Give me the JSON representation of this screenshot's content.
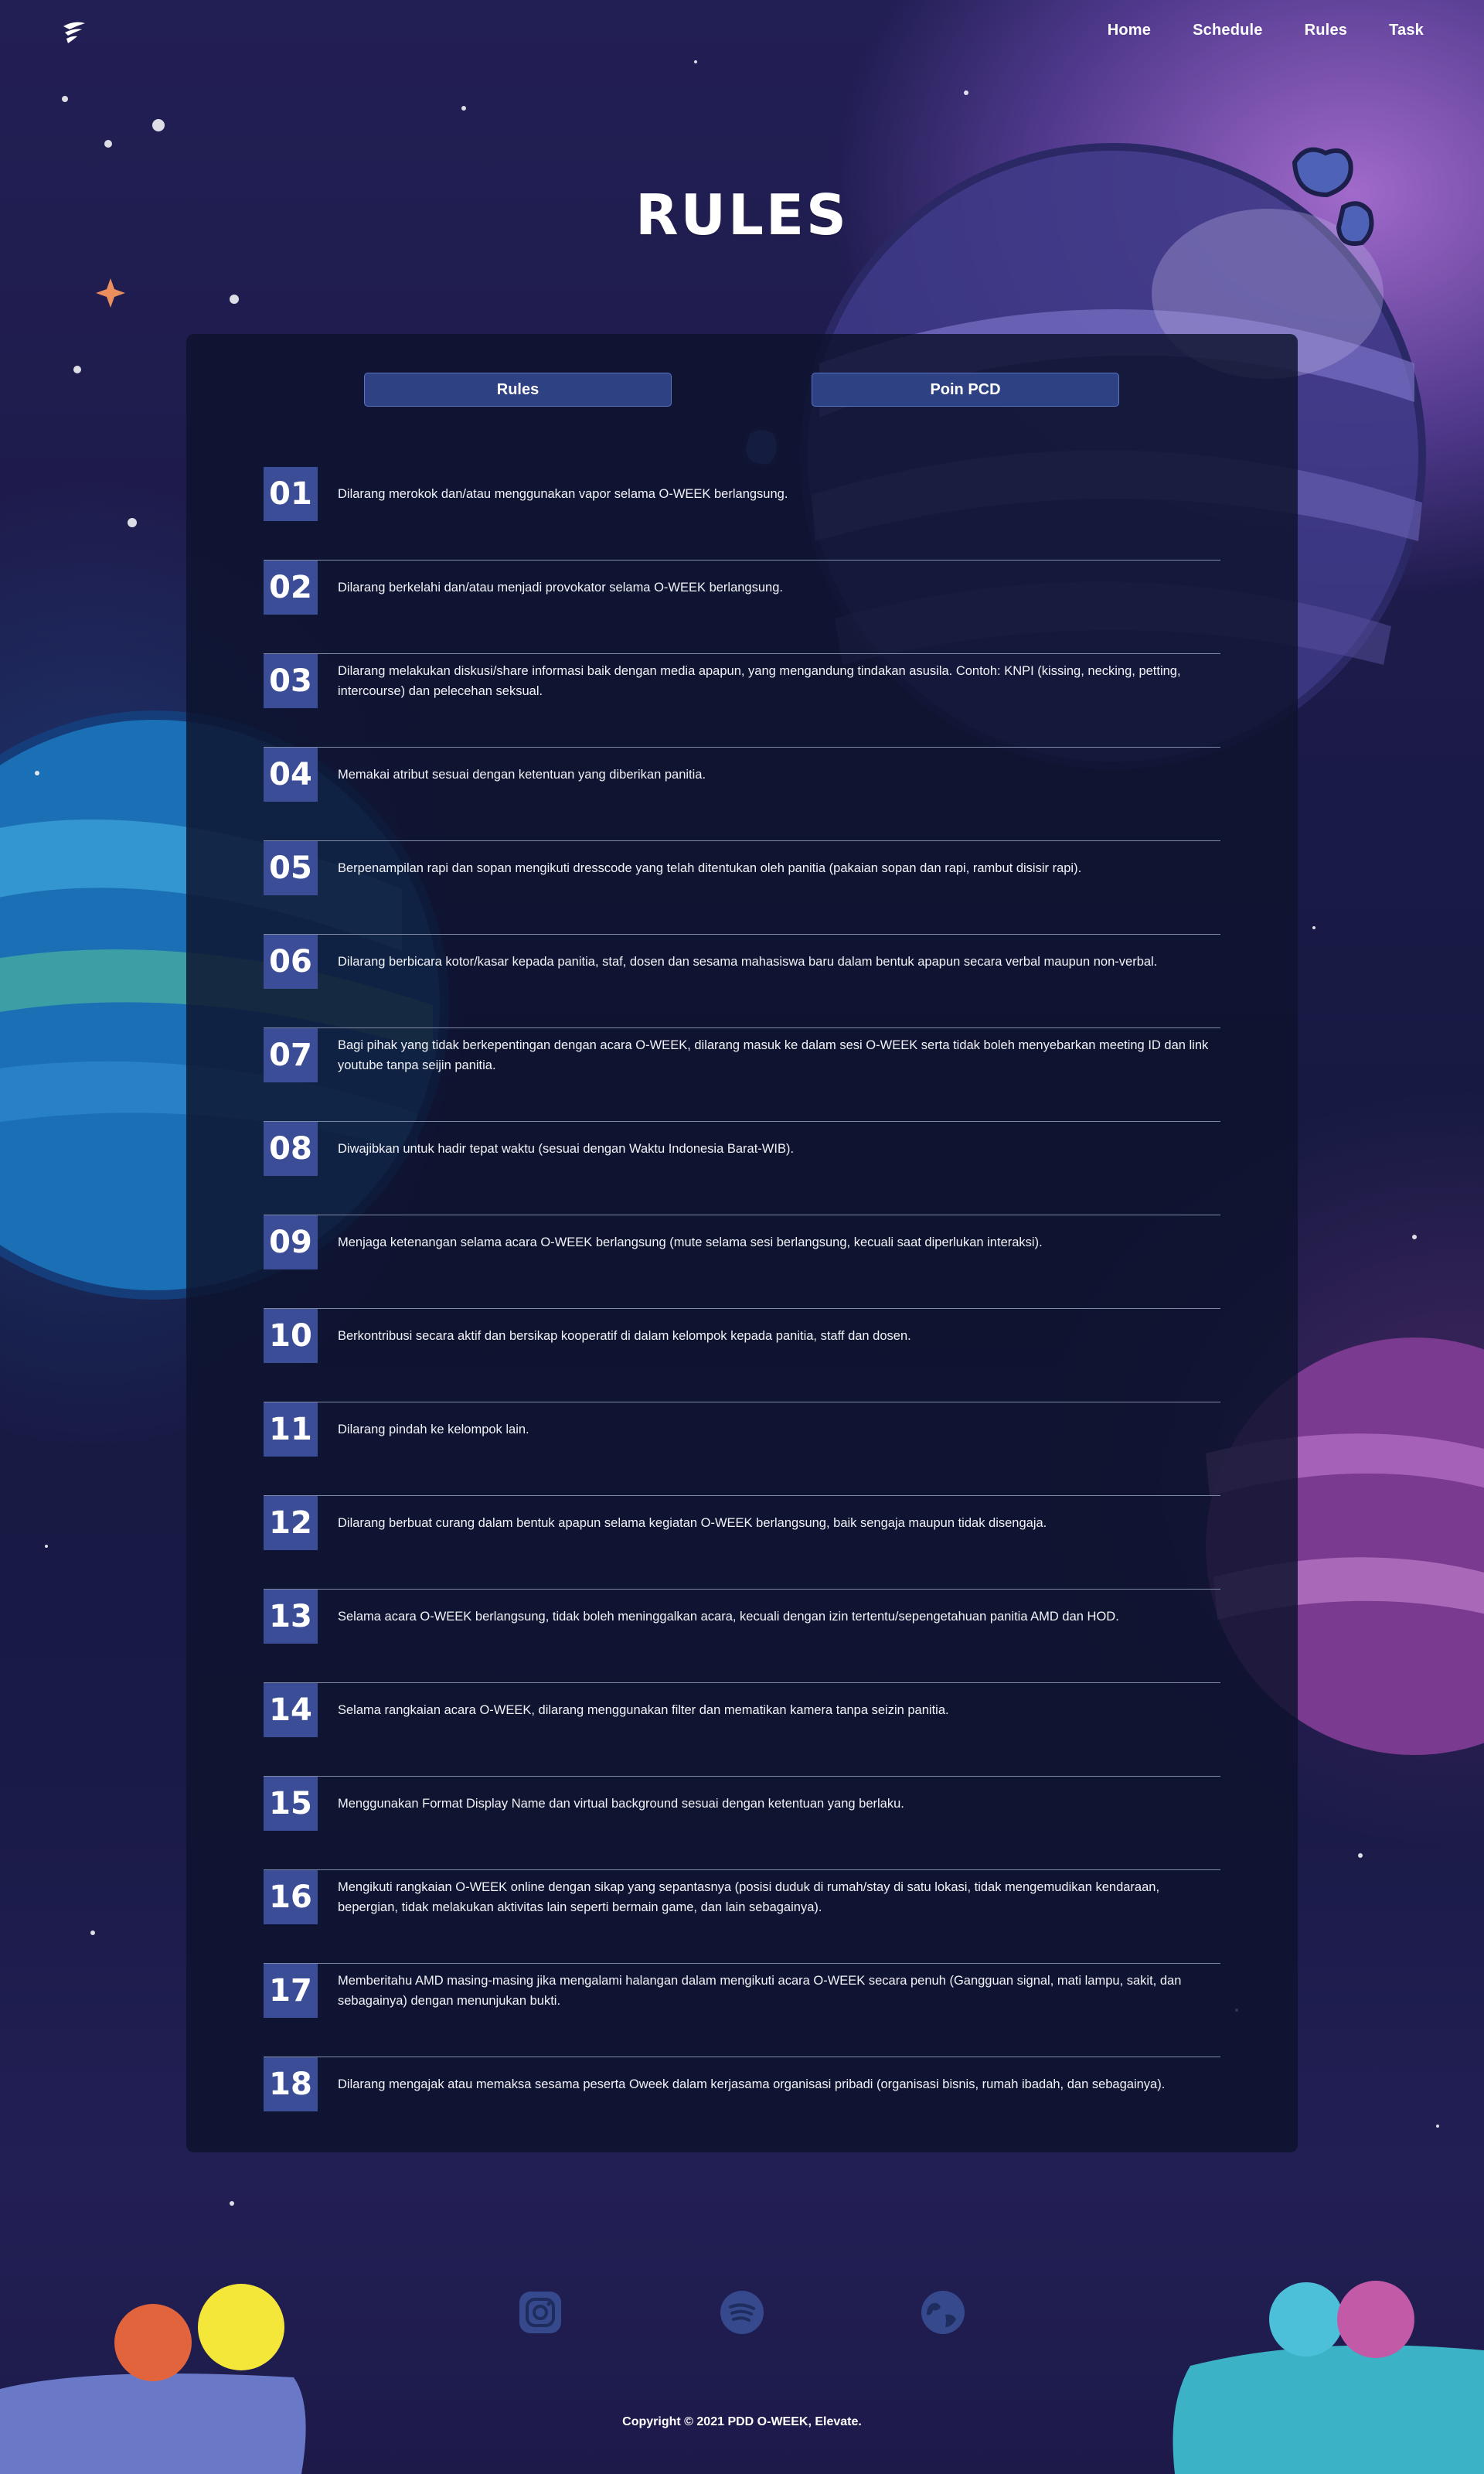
{
  "nav": {
    "logo_icon": "wing-logo-icon",
    "links": [
      {
        "label": "Home"
      },
      {
        "label": "Schedule"
      },
      {
        "label": "Rules"
      },
      {
        "label": "Task"
      }
    ]
  },
  "page": {
    "title": "RULES"
  },
  "tabs": [
    {
      "label": "Rules"
    },
    {
      "label": "Poin PCD"
    }
  ],
  "rules": [
    {
      "number": "01",
      "text": "Dilarang merokok dan/atau menggunakan vapor selama O-WEEK berlangsung."
    },
    {
      "number": "02",
      "text": "Dilarang berkelahi dan/atau menjadi provokator selama O-WEEK berlangsung."
    },
    {
      "number": "03",
      "text": "Dilarang melakukan diskusi/share informasi baik dengan media apapun, yang mengandung tindakan asusila. Contoh: KNPI (kissing, necking, petting, intercourse) dan pelecehan seksual."
    },
    {
      "number": "04",
      "text": "Memakai atribut sesuai dengan ketentuan yang diberikan panitia."
    },
    {
      "number": "05",
      "text": "Berpenampilan rapi dan sopan mengikuti dresscode yang telah ditentukan oleh panitia (pakaian sopan dan rapi, rambut disisir rapi)."
    },
    {
      "number": "06",
      "text": "Dilarang berbicara kotor/kasar kepada panitia, staf, dosen dan sesama mahasiswa baru dalam bentuk apapun secara verbal maupun non-verbal."
    },
    {
      "number": "07",
      "text": "Bagi pihak yang tidak berkepentingan dengan acara O-WEEK, dilarang masuk ke dalam sesi O-WEEK serta tidak boleh menyebarkan meeting ID dan link youtube tanpa seijin panitia."
    },
    {
      "number": "08",
      "text": "Diwajibkan untuk hadir tepat waktu (sesuai dengan Waktu Indonesia Barat-WIB)."
    },
    {
      "number": "09",
      "text": "Menjaga ketenangan selama acara O-WEEK berlangsung (mute selama sesi berlangsung, kecuali saat diperlukan interaksi)."
    },
    {
      "number": "10",
      "text": "Berkontribusi secara aktif dan bersikap kooperatif di dalam kelompok kepada panitia, staff dan dosen."
    },
    {
      "number": "11",
      "text": "Dilarang pindah ke kelompok lain."
    },
    {
      "number": "12",
      "text": "Dilarang berbuat curang dalam bentuk apapun selama kegiatan O-WEEK berlangsung, baik sengaja maupun tidak disengaja."
    },
    {
      "number": "13",
      "text": "Selama acara O-WEEK berlangsung, tidak boleh meninggalkan acara, kecuali dengan izin tertentu/sepengetahuan panitia AMD dan HOD."
    },
    {
      "number": "14",
      "text": "Selama rangkaian acara O-WEEK, dilarang menggunakan filter dan mematikan kamera tanpa seizin panitia."
    },
    {
      "number": "15",
      "text": "Menggunakan Format Display Name dan virtual background sesuai dengan ketentuan yang berlaku."
    },
    {
      "number": "16",
      "text": "Mengikuti rangkaian O-WEEK online dengan sikap yang sepantasnya (posisi duduk di rumah/stay di satu lokasi, tidak mengemudikan kendaraan, bepergian, tidak melakukan aktivitas lain seperti bermain game, dan lain sebagainya)."
    },
    {
      "number": "17",
      "text": "Memberitahu AMD masing-masing jika mengalami halangan dalam mengikuti acara O-WEEK secara penuh (Gangguan signal, mati lampu, sakit, dan sebagainya) dengan menunjukan bukti."
    },
    {
      "number": "18",
      "text": "Dilarang mengajak atau memaksa sesama peserta Oweek dalam kerjasama organisasi pribadi (organisasi bisnis, rumah ibadah, dan sebagainya)."
    }
  ],
  "footer": {
    "icons": [
      {
        "name": "instagram-icon"
      },
      {
        "name": "spotify-icon"
      },
      {
        "name": "globe-icon"
      }
    ],
    "copyright": "Copyright © 2021 PDD O-WEEK, Elevate."
  },
  "colors": {
    "panel": "#0d132d",
    "number_box": "#3b4d96",
    "tab_button": "#2e4283",
    "divider": "#7f8aa6"
  }
}
